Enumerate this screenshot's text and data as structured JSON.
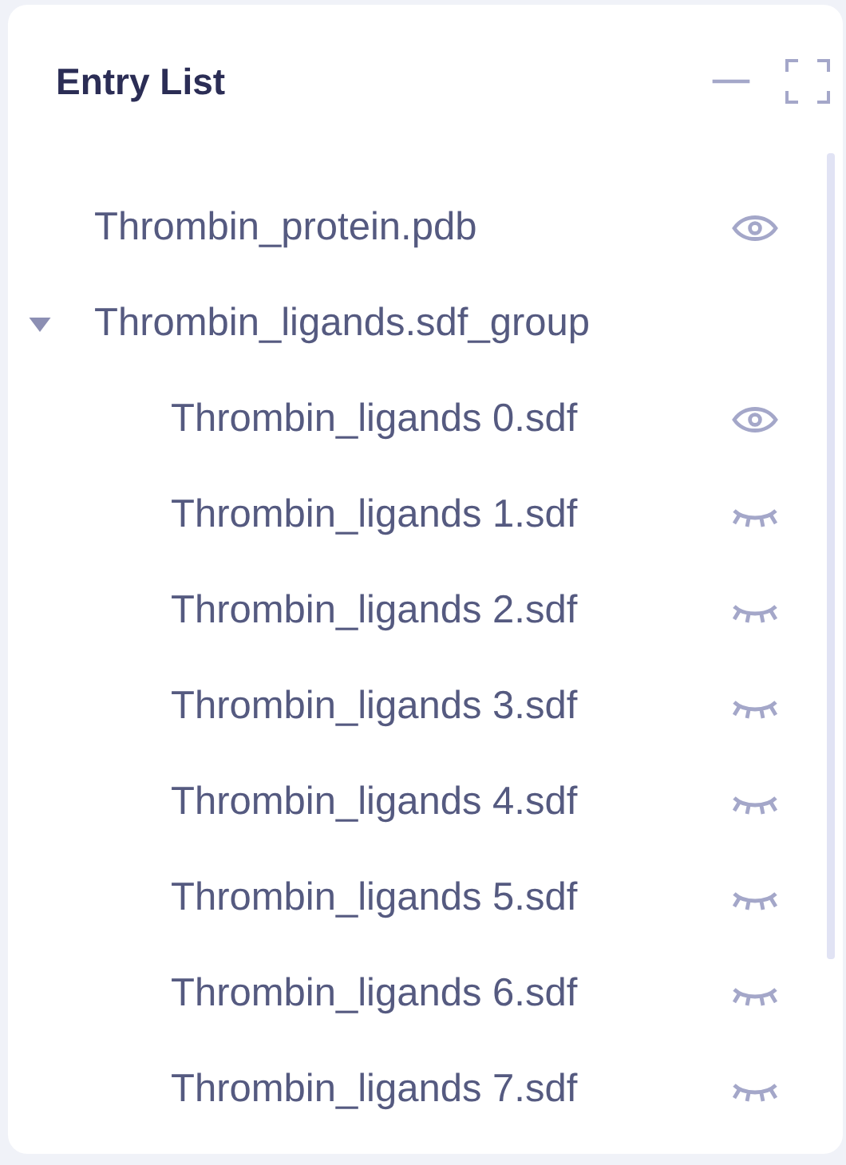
{
  "panel": {
    "title": "Entry List"
  },
  "entries": [
    {
      "name": "Thrombin_protein.pdb",
      "visible": true
    },
    {
      "name": "Thrombin_ligands.sdf_group",
      "expanded": true,
      "children": [
        {
          "name": "Thrombin_ligands 0.sdf",
          "visible": true
        },
        {
          "name": "Thrombin_ligands 1.sdf",
          "visible": false
        },
        {
          "name": "Thrombin_ligands 2.sdf",
          "visible": false
        },
        {
          "name": "Thrombin_ligands 3.sdf",
          "visible": false
        },
        {
          "name": "Thrombin_ligands 4.sdf",
          "visible": false
        },
        {
          "name": "Thrombin_ligands 5.sdf",
          "visible": false
        },
        {
          "name": "Thrombin_ligands 6.sdf",
          "visible": false
        },
        {
          "name": "Thrombin_ligands 7.sdf",
          "visible": false
        }
      ]
    }
  ]
}
